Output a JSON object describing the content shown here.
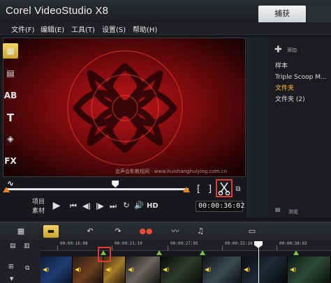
{
  "app": {
    "title": "Corel VideoStudio X8"
  },
  "tabs": [
    {
      "label": "捕获",
      "active": true
    },
    {
      "label": "",
      "active": false
    }
  ],
  "menu": [
    {
      "label": "文件(F)"
    },
    {
      "label": "编辑(E)"
    },
    {
      "label": "工具(T)"
    },
    {
      "label": "设置(S)"
    },
    {
      "label": "帮助(H)"
    }
  ],
  "preview": {
    "watermark": "会声会影教程网 · www.huishanghuiying.com.cn",
    "playback_progress": 0.6
  },
  "player": {
    "mode_project": "项目",
    "mode_clip": "素材",
    "hd_label": "HD",
    "mark_in": "[",
    "mark_out": "]",
    "timecode": "00:00:36:02",
    "icons": [
      "play-icon",
      "rewind-start-icon",
      "step-back-icon",
      "step-forward-icon",
      "skip-end-icon",
      "repeat-icon",
      "volume-icon",
      "split-clip-icon",
      "enlarge-icon"
    ]
  },
  "library": {
    "add_label": "添加",
    "browse_label": "浏览",
    "folders": [
      {
        "label": "样本",
        "selected": false
      },
      {
        "label": "Triple Scoop M...",
        "selected": false
      },
      {
        "label": "文件夹",
        "selected": true
      },
      {
        "label": "文件夹 (2)",
        "selected": false
      }
    ],
    "category_icons": [
      "media-icon",
      "instant-project-icon",
      "transition-icon",
      "title-icon",
      "graphic-icon",
      "filter-icon",
      "path-icon"
    ],
    "category_text": {
      "title": "T",
      "filter": "FX"
    }
  },
  "timeline": {
    "toolbar_icons": [
      "storyboard-view-icon",
      "timeline-view-icon",
      "undo-icon",
      "redo-icon",
      "record-capture-icon",
      "sound-mixer-icon",
      "auto-music-icon",
      "subtitle-icon"
    ],
    "ruler": [
      "00:00:16:08",
      "00:00:21:19",
      "00:00:27:05",
      "00:00:32:16",
      "00:00:38:02"
    ],
    "playhead_time": "00:00:36:02"
  },
  "colors": {
    "accent_orange": "#f0821e",
    "highlight_red": "#e53935",
    "selected_gold": "#ffbf2f",
    "marker_green": "#7cc243"
  }
}
